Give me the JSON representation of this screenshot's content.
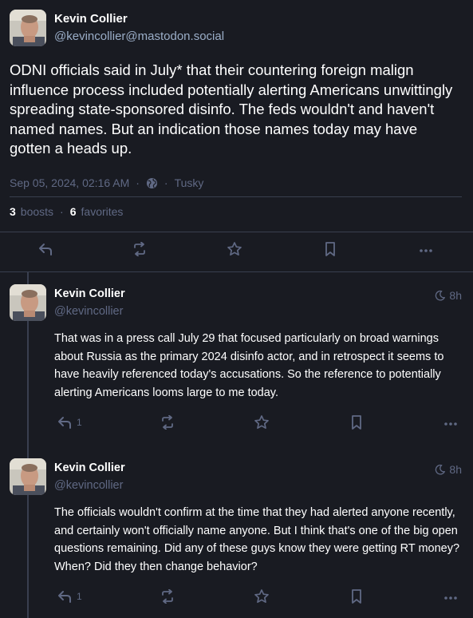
{
  "main": {
    "display_name": "Kevin Collier",
    "acct": "@kevincollier@mastodon.social",
    "text": "ODNI officials said in July* that their countering foreign malign influence process included potentially alerting Americans unwittingly spreading state-sponsored disinfo. The feds wouldn't and haven't named names. But an indication those names today may have gotten a heads up.",
    "timestamp": "Sep 05, 2024, 02:16 AM",
    "separator": "·",
    "visibility_icon": "globe-icon",
    "application": "Tusky",
    "boosts_count": "3",
    "boosts_label": "boosts",
    "favorites_count": "6",
    "favorites_label": "favorites"
  },
  "replies": [
    {
      "display_name": "Kevin Collier",
      "acct": "@kevincollier",
      "time": "8h",
      "text": "That was in a press call July 29 that focused particularly on broad warnings about Russia as the primary 2024 disinfo actor, and in retrospect it seems to have heavily referenced today's accusations. So the reference to potentially alerting Americans looms large to me today.",
      "reply_count": "1"
    },
    {
      "display_name": "Kevin Collier",
      "acct": "@kevincollier",
      "time": "8h",
      "text": "The officials wouldn't confirm at the time that they had alerted anyone recently, and certainly won't officially name anyone. But I think that's one of the big open questions remaining. Did any of these guys know they were getting RT money? When? Did they then change behavior?",
      "reply_count": "1"
    }
  ],
  "colors": {
    "background": "#191b22",
    "text": "#ffffff",
    "secondary": "#9baec8",
    "muted": "#606984",
    "divider": "#393f4f"
  }
}
